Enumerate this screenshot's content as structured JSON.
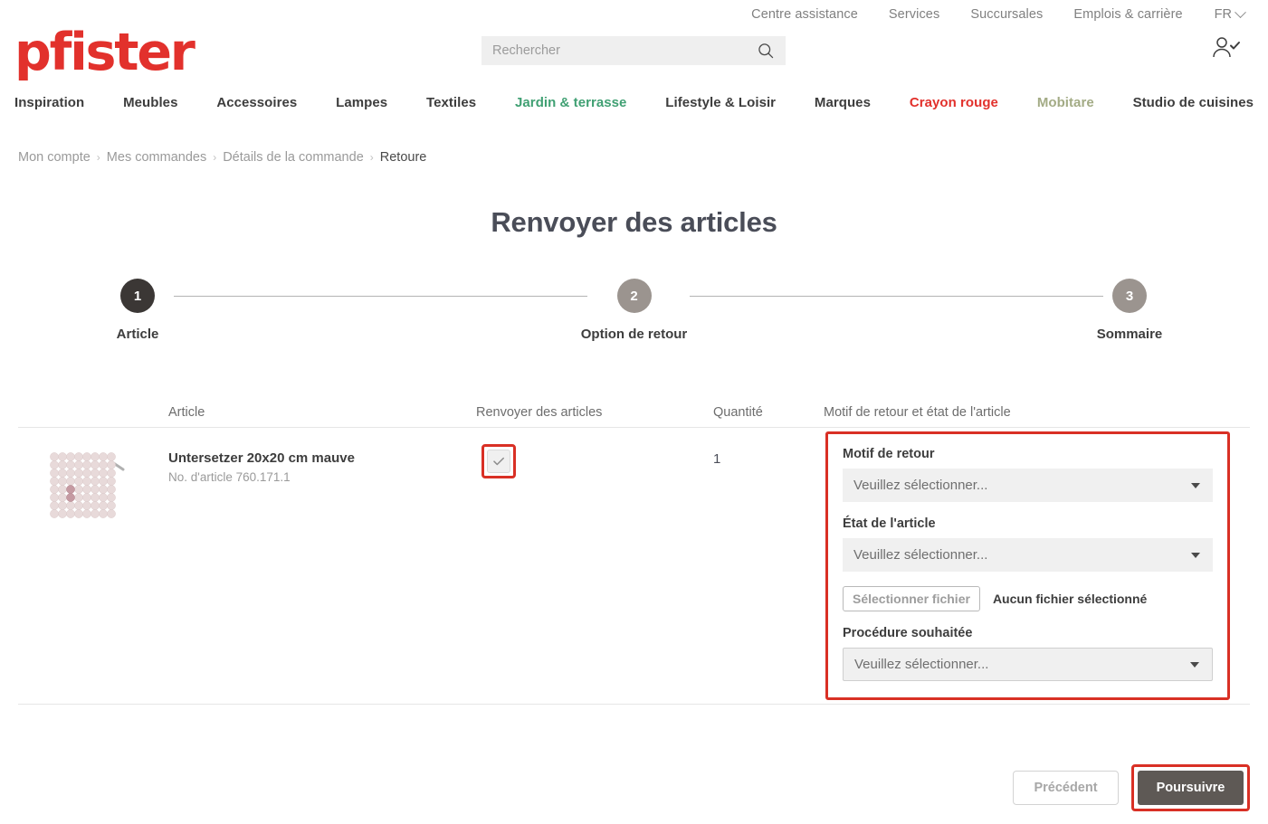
{
  "utility_bar": {
    "links": [
      {
        "label": "Centre assistance"
      },
      {
        "label": "Services"
      },
      {
        "label": "Succursales"
      },
      {
        "label": "Emplois & carrière"
      }
    ],
    "language": "FR"
  },
  "header": {
    "logo_text": "pfister",
    "logo_color": "#e2312c",
    "search": {
      "placeholder": "Rechercher",
      "value": "",
      "icon": "search-icon"
    },
    "account_icon": "user-check-icon"
  },
  "main_nav": {
    "items": [
      {
        "label": "Inspiration",
        "color": "#3d3d3d"
      },
      {
        "label": "Meubles",
        "color": "#3d3d3d"
      },
      {
        "label": "Accessoires",
        "color": "#3d3d3d"
      },
      {
        "label": "Lampes",
        "color": "#3d3d3d"
      },
      {
        "label": "Textiles",
        "color": "#3d3d3d"
      },
      {
        "label": "Jardin & terrasse",
        "color": "#40a073"
      },
      {
        "label": "Lifestyle & Loisir",
        "color": "#3d3d3d"
      },
      {
        "label": "Marques",
        "color": "#3d3d3d"
      },
      {
        "label": "Crayon rouge",
        "color": "#e2312c"
      },
      {
        "label": "Mobitare",
        "color": "#a3ab85"
      },
      {
        "label": "Studio de cuisines",
        "color": "#3d3d3d"
      }
    ]
  },
  "breadcrumb": {
    "items": [
      {
        "label": "Mon compte",
        "current": false
      },
      {
        "label": "Mes commandes",
        "current": false
      },
      {
        "label": "Détails de la commande",
        "current": false
      },
      {
        "label": "Retoure",
        "current": true
      }
    ],
    "separator": "›"
  },
  "page": {
    "title": "Renvoyer des articles"
  },
  "stepper": {
    "steps": [
      {
        "number": "1",
        "label": "Article",
        "state": "active",
        "color": "#3b3735"
      },
      {
        "number": "2",
        "label": "Option de retour",
        "state": "inactive",
        "color": "#9b948f"
      },
      {
        "number": "3",
        "label": "Sommaire",
        "state": "inactive",
        "color": "#9b948f"
      }
    ]
  },
  "table": {
    "headers": {
      "article": "Article",
      "return": "Renvoyer des articles",
      "quantity": "Quantité",
      "reason": "Motif de retour et état de l'article"
    },
    "rows": [
      {
        "product_name": "Untersetzer 20x20 cm mauve",
        "product_sku": "No. d'article 760.171.1",
        "quantity": "1",
        "checked": true
      }
    ]
  },
  "return_panel": {
    "highlight_color": "#d93025",
    "reason_label": "Motif de retour",
    "reason_value": "Veuillez sélectionner...",
    "condition_label": "État de l'article",
    "condition_value": "Veuillez sélectionner...",
    "file_button_label": "Sélectionner fichier",
    "file_status": "Aucun fichier sélectionné",
    "procedure_label": "Procédure souhaitée",
    "procedure_value": "Veuillez sélectionner..."
  },
  "footer": {
    "prev_label": "Précédent",
    "next_label": "Poursuivre"
  }
}
